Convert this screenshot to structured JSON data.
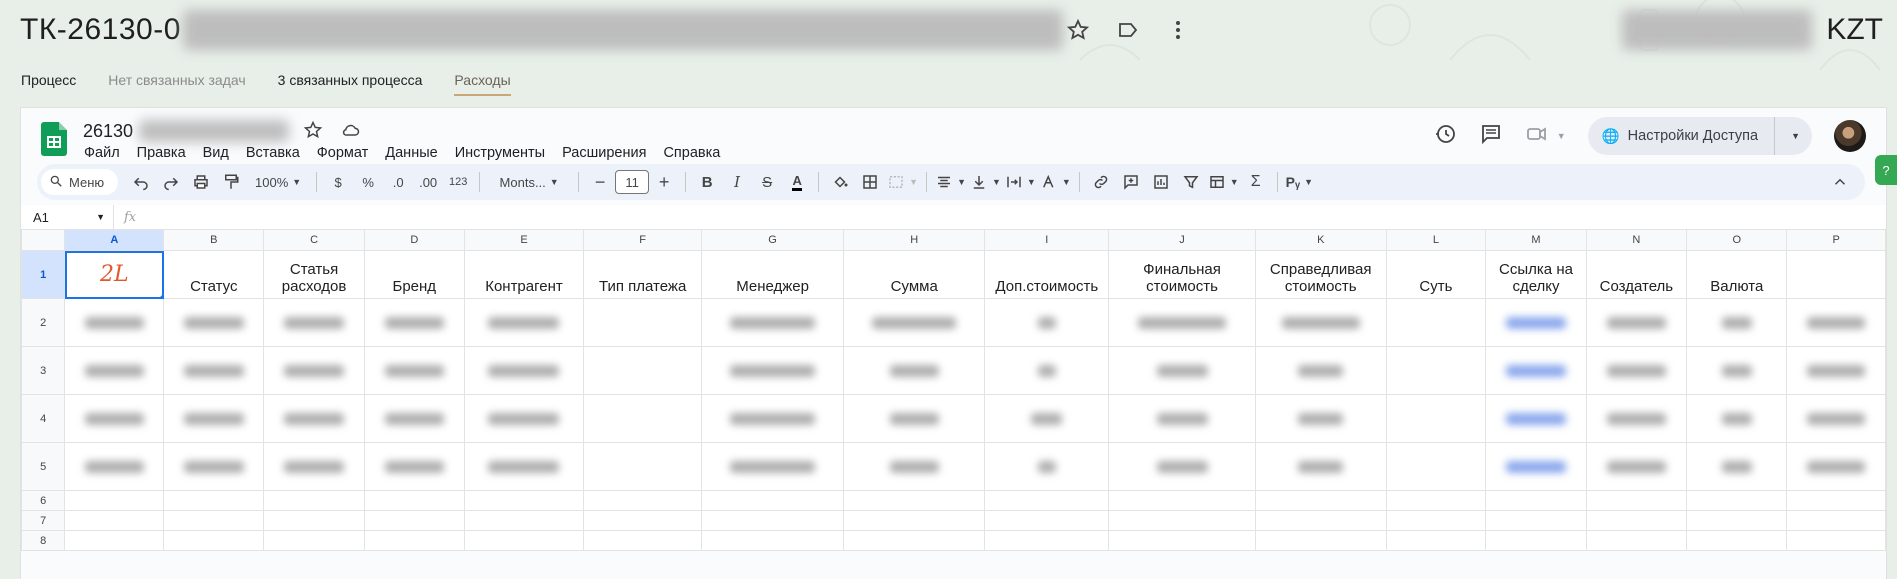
{
  "page": {
    "title": "ТК-26130-0",
    "currency": "KZT",
    "tabs": [
      "Процесс",
      "Нет связанных задач",
      "3 связанных процесса",
      "Расходы"
    ]
  },
  "sheet": {
    "doc_name": "26130",
    "menu": [
      "Файл",
      "Правка",
      "Вид",
      "Вставка",
      "Формат",
      "Данные",
      "Инструменты",
      "Расширения",
      "Справка"
    ],
    "share_label": "Настройки Доступа",
    "toolbar": {
      "search_label": "Меню",
      "zoom": "100%",
      "currency_symbol": "$",
      "percent_symbol": "%",
      "dec_decrease": ".0",
      "dec_increase": ".00",
      "number_format": "123",
      "font": "Monts...",
      "font_size": "11"
    },
    "name_box": "A1",
    "fx": "fx",
    "columns": [
      "A",
      "B",
      "C",
      "D",
      "E",
      "F",
      "G",
      "H",
      "I",
      "J",
      "K",
      "L",
      "M",
      "N",
      "O",
      "P"
    ],
    "header_row": [
      "",
      "Статус",
      "Статья расходов",
      "Бренд",
      "Контрагент",
      "Тип платежа",
      "Менеджер",
      "Сумма",
      "Доп.стоимость",
      "Финальная стоимость",
      "Справедливая стоимость",
      "Суть",
      "Ссылка на сделку",
      "Создатель",
      "Валюта",
      ""
    ],
    "row_numbers": [
      "1",
      "2",
      "3",
      "4",
      "5",
      "6",
      "7",
      "8"
    ]
  },
  "icons": {
    "title": [
      "star-outline-icon",
      "label-icon",
      "more-vert-icon"
    ],
    "doc": [
      "star-icon",
      "cloud-icon"
    ],
    "right": [
      "history-icon",
      "comment-icon",
      "video-camera-icon",
      "globe-icon"
    ]
  }
}
